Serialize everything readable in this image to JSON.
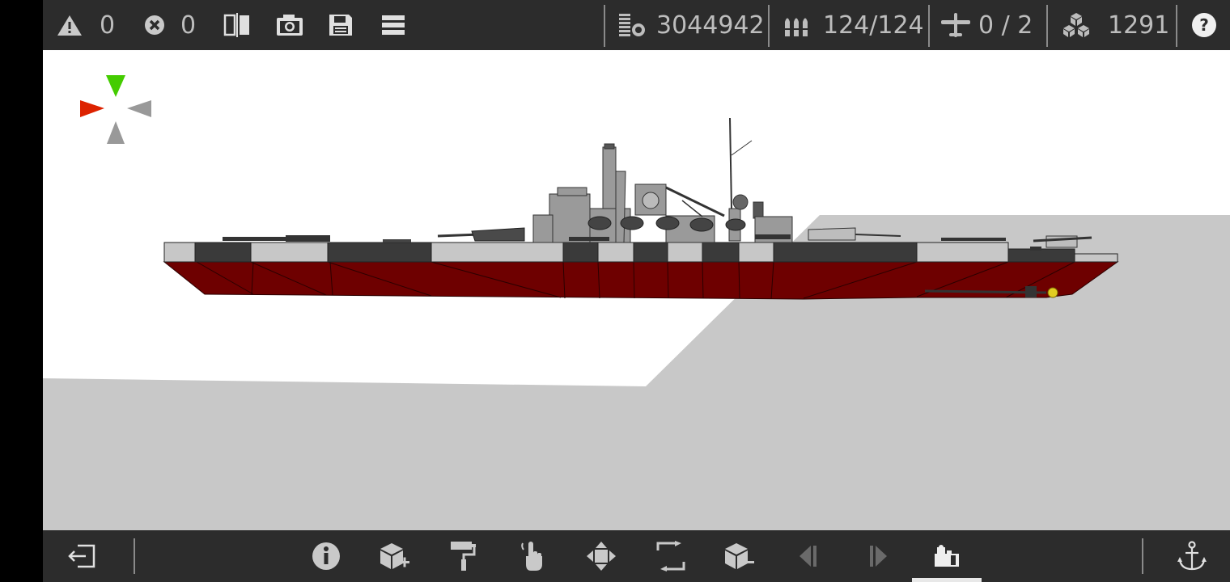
{
  "topbar": {
    "warnings_count": "0",
    "errors_count": "0",
    "cost": "3044942",
    "ammo": "124/124",
    "aircraft": "0 / 2",
    "parts": "1291",
    "icons": {
      "warnings": "warning-triangle-icon",
      "errors": "error-x-icon",
      "mirror": "mirror-icon",
      "screenshot": "camera-icon",
      "save": "save-icon",
      "menu": "menu-icon",
      "cost": "cost-icon",
      "ammo": "ammo-icon",
      "aircraft": "airplane-icon",
      "parts": "parts-icon",
      "help": "help-icon"
    }
  },
  "viewport": {
    "background": "#ffffff",
    "floor_color": "#c8c8c8",
    "hull_red": "#6e0000",
    "camo_dark": "#3a3a3a",
    "camo_light": "#c7c7c7",
    "axis_colors": {
      "up": "#44cc00",
      "left": "#dd2200",
      "right": "#999999",
      "down": "#999999"
    }
  },
  "bottombar": {
    "active_tool": "view-mode",
    "icons": {
      "exit": "exit-icon",
      "info": "info-icon",
      "add_part": "add-part-icon",
      "paint": "paint-roller-icon",
      "select": "hand-pointer-icon",
      "move": "move-icon",
      "scale": "scale-icon",
      "remove_part": "remove-part-icon",
      "undo": "undo-icon",
      "redo": "redo-icon",
      "view": "view-mode-icon",
      "anchor": "anchor-icon"
    }
  }
}
